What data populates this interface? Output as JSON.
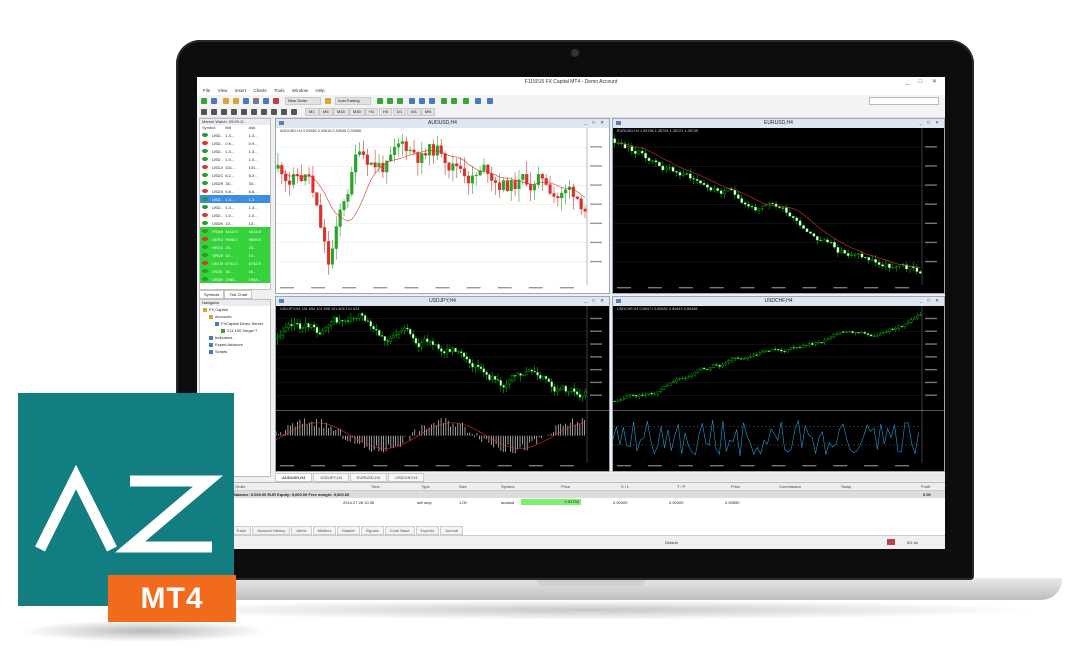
{
  "window": {
    "title": "F115015 FX Capital MT4 - Demo Account",
    "buttons": "_ □ ✕"
  },
  "menu": [
    "File",
    "View",
    "Insert",
    "Charts",
    "Tools",
    "Window",
    "Help"
  ],
  "toolbar": {
    "new_order": "New Order",
    "autotrading": "AutoTrading"
  },
  "timeframes": [
    "M1",
    "M5",
    "M15",
    "M30",
    "H1",
    "H4",
    "D1",
    "W1",
    "MN"
  ],
  "market_watch": {
    "header": "Market Watch: 09:05:11",
    "columns": [
      "Symbol",
      "Bid",
      "Ask"
    ],
    "rows": [
      {
        "symbol": "USD...",
        "bid": "1.3...",
        "ask": "1.3..."
      },
      {
        "symbol": "USD...",
        "bid": "0.9...",
        "ask": "0.9..."
      },
      {
        "symbol": "USD...",
        "bid": "1.3...",
        "ask": "1.3..."
      },
      {
        "symbol": "USD...",
        "bid": "1.0...",
        "ask": "1.0..."
      },
      {
        "symbol": "USDJPY",
        "bid": "101...",
        "ask": "101..."
      },
      {
        "symbol": "USDCNH",
        "bid": "6.2...",
        "ask": "6.2..."
      },
      {
        "symbol": "USDRUB",
        "bid": "34...",
        "ask": "34..."
      },
      {
        "symbol": "USDSEK",
        "bid": "6.8...",
        "ask": "6.8..."
      },
      {
        "symbol": "USD...",
        "bid": "1.3...",
        "ask": "1.3..."
      },
      {
        "symbol": "USD...",
        "bid": "1.3...",
        "ask": "1.3..."
      },
      {
        "symbol": "USD...",
        "bid": "1.0...",
        "ask": "1.0..."
      },
      {
        "symbol": "USDMXN",
        "bid": "13...",
        "ask": "13..."
      },
      {
        "symbol": "FRA40",
        "bid": "4413.5",
        "ask": "4414.5"
      },
      {
        "symbol": "GER30",
        "bid": "9908.0",
        "ask": "9909.0"
      },
      {
        "symbol": "HKG33",
        "bid": "23...",
        "ask": "23..."
      },
      {
        "symbol": "SPA35",
        "bid": "10...",
        "ask": "10..."
      },
      {
        "symbol": "UK100",
        "bid": "6741.0",
        "ask": "6742.0"
      },
      {
        "symbol": "US30",
        "bid": "16...",
        "ask": "16..."
      },
      {
        "symbol": "US500",
        "bid": "1963...",
        "ask": "1964..."
      }
    ],
    "tabs": [
      "Symbols",
      "Tick Chart"
    ]
  },
  "navigator": {
    "header": "Navigator",
    "items": [
      "FX Capital",
      "Accounts",
      "FXCapital Demo Server",
      "211 100 Sergei T",
      "Indicators",
      "Expert Advisors",
      "Scripts"
    ]
  },
  "charts": [
    {
      "title": "AUDUSD,H4",
      "symbol": "AUDUSD,H4  0.93550 0.93616 0.93548 0.93566"
    },
    {
      "title": "EURUSD,H4",
      "symbol": "EURUSD,H4  1.35786 1.35794 1.35721 1.35745"
    },
    {
      "title": "USDJPY,H4",
      "symbol": "USDJPY,H4  101.594 101.596 101.505 101.524"
    },
    {
      "title": "USDCHF,H4",
      "symbol": "USDCHF,H4  0.89471 0.89492 0.89443 0.89458"
    }
  ],
  "chart_tabs": [
    "AUDUSD,H4",
    "USDJPY,H4",
    "EURUSD,H4",
    "USDCHF,H4"
  ],
  "terminal": {
    "headers": [
      "Order",
      "Time",
      "Type",
      "Size",
      "Symbol",
      "Price",
      "S / L",
      "T / P",
      "Price",
      "Commission",
      "Swap",
      "Profit"
    ],
    "balance": "Balance: 5,000.00 EUR  Equity: 5,000.00  Free margin: 5,000.00",
    "balance_profit": "0.00",
    "row": {
      "time": "2014.07.28 10:35",
      "type": "sell stop",
      "size": "1.00",
      "symbol": "audusd",
      "price": "0.93750",
      "sl": "0.00000",
      "tp": "0.00000",
      "price2": "0.93550"
    },
    "tabs": [
      "Trade",
      "Account History",
      "Alerts",
      "Mailbox",
      "Market",
      "Signals",
      "Code Base",
      "Experts",
      "Journal"
    ]
  },
  "status": {
    "help": "For Help, press F1",
    "profile": "Default",
    "memory": "5/1 kb"
  },
  "badge": {
    "logo": "AZ",
    "label": "MT4"
  },
  "colors": {
    "teal": "#137e81",
    "orange": "#f26a1c",
    "bull": "#00c000",
    "selected": "#3a8ee6",
    "index_row": "#35d23a"
  }
}
